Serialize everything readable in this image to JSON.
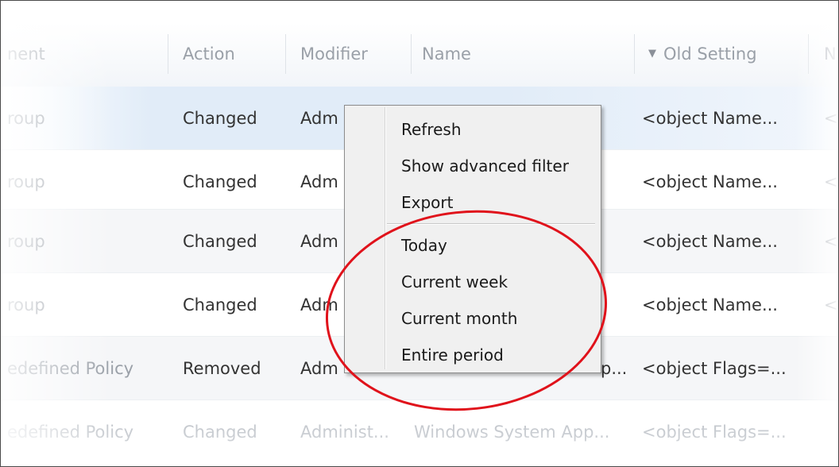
{
  "header": {
    "columns": [
      "nent",
      "Action",
      "Modifier",
      "Name",
      "Old Setting",
      "N"
    ]
  },
  "rows": [
    {
      "group": "roup",
      "action": "Changed",
      "modifier": "Adm",
      "name": "",
      "old_setting": "<object Name...",
      "extra": "<"
    },
    {
      "group": "roup",
      "action": "Changed",
      "modifier": "Adm",
      "name": "",
      "old_setting": "<object Name...",
      "extra": "<"
    },
    {
      "group": "roup",
      "action": "Changed",
      "modifier": "Adm",
      "name": "",
      "old_setting": "<object Name...",
      "extra": "<"
    },
    {
      "group": "roup",
      "action": "Changed",
      "modifier": "Adm",
      "name": "",
      "old_setting": "<object Name...",
      "extra": "<"
    },
    {
      "group": "edefined Policy",
      "action": "Removed",
      "modifier": "Adm",
      "name": "p...",
      "old_setting": "<object Flags=...",
      "extra": ""
    },
    {
      "group": "edefined Policy",
      "action": "Changed",
      "modifier": "Administ...",
      "name": "Windows System App...",
      "old_setting": "<object Flags=...",
      "extra": ""
    }
  ],
  "context_menu": {
    "items": [
      "Refresh",
      "Show advanced filter",
      "Export"
    ],
    "period_items": [
      "Today",
      "Current week",
      "Current month",
      "Entire period"
    ]
  },
  "icons": {
    "sort": "sort-descending-icon"
  },
  "colors": {
    "highlight_ellipse": "#e0121b",
    "selected_row": "#e1ecf8"
  }
}
